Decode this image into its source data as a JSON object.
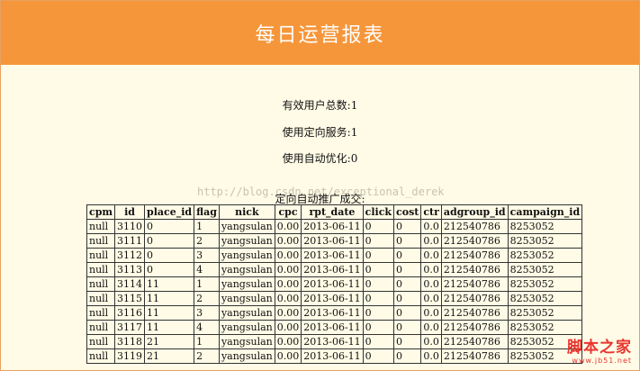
{
  "header": {
    "title": "每日运营报表"
  },
  "stats": {
    "valid_users": "有效用户总数:1",
    "targeting_service": "使用定向服务:1",
    "auto_optimize": "使用自动优化:0",
    "auto_promo_deals": "定向自动推广成交:"
  },
  "watermark": "http://blog.csdn.net/exceptional_derek",
  "table": {
    "headers": [
      "cpm",
      "id",
      "place_id",
      "flag",
      "nick",
      "cpc",
      "rpt_date",
      "click",
      "cost",
      "ctr",
      "adgroup_id",
      "campaign_id"
    ],
    "rows": [
      [
        "null",
        "3110",
        "0",
        "1",
        "yangsulan",
        "0.00",
        "2013-06-11",
        "0",
        "0",
        "0.0",
        "212540786",
        "8253052"
      ],
      [
        "null",
        "3111",
        "0",
        "2",
        "yangsulan",
        "0.00",
        "2013-06-11",
        "0",
        "0",
        "0.0",
        "212540786",
        "8253052"
      ],
      [
        "null",
        "3112",
        "0",
        "3",
        "yangsulan",
        "0.00",
        "2013-06-11",
        "0",
        "0",
        "0.0",
        "212540786",
        "8253052"
      ],
      [
        "null",
        "3113",
        "0",
        "4",
        "yangsulan",
        "0.00",
        "2013-06-11",
        "0",
        "0",
        "0.0",
        "212540786",
        "8253052"
      ],
      [
        "null",
        "3114",
        "11",
        "1",
        "yangsulan",
        "0.00",
        "2013-06-11",
        "0",
        "0",
        "0.0",
        "212540786",
        "8253052"
      ],
      [
        "null",
        "3115",
        "11",
        "2",
        "yangsulan",
        "0.00",
        "2013-06-11",
        "0",
        "0",
        "0.0",
        "212540786",
        "8253052"
      ],
      [
        "null",
        "3116",
        "11",
        "3",
        "yangsulan",
        "0.00",
        "2013-06-11",
        "0",
        "0",
        "0.0",
        "212540786",
        "8253052"
      ],
      [
        "null",
        "3117",
        "11",
        "4",
        "yangsulan",
        "0.00",
        "2013-06-11",
        "0",
        "0",
        "0.0",
        "212540786",
        "8253052"
      ],
      [
        "null",
        "3118",
        "21",
        "1",
        "yangsulan",
        "0.00",
        "2013-06-11",
        "0",
        "0",
        "0.0",
        "212540786",
        "8253052"
      ],
      [
        "null",
        "3119",
        "21",
        "2",
        "yangsulan",
        "0.00",
        "2013-06-11",
        "0",
        "0",
        "0.0",
        "212540786",
        "8253052"
      ]
    ]
  },
  "logo": {
    "name": "脚本之家",
    "url": "www.jb51.net"
  }
}
